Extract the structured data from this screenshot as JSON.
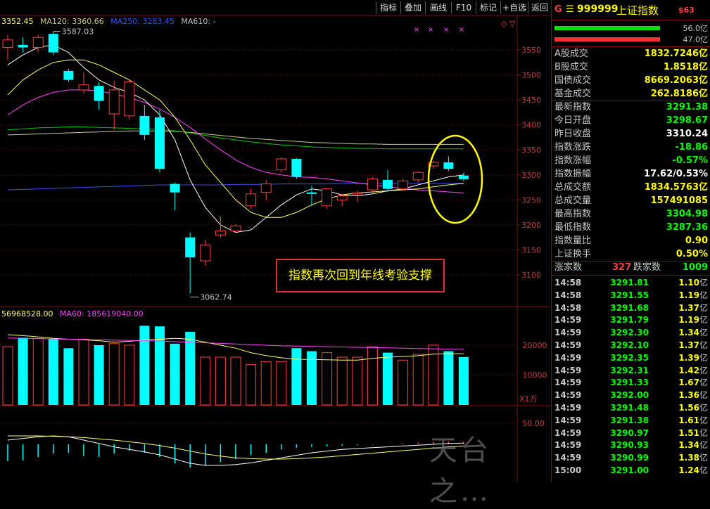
{
  "toolbar": {
    "buttons": [
      "指标",
      "叠加",
      "画线",
      "F10",
      "标记",
      "+自选",
      "返回"
    ]
  },
  "ma_legend": {
    "ma_a": "3352.45",
    "ma120": "MA120: 3360.66",
    "ma250": "MA250: 3283.45",
    "ma610": "MA610: -"
  },
  "price_axis": [
    "3550",
    "3500",
    "3450",
    "3400",
    "3350",
    "3300",
    "3250",
    "3200",
    "3150",
    "3100"
  ],
  "annotations": {
    "high_label": "3587.03",
    "low_label": "3062.74",
    "box_text": "指数再次回到年线考验支撑"
  },
  "volume": {
    "legend_vol": "56968528.00",
    "legend_ma60": "MA60: 185619040.00",
    "axis": [
      "20000",
      "10000"
    ],
    "unit": "X1万"
  },
  "macd_axis": [
    "50.00"
  ],
  "watermark": "天台之…",
  "panel": {
    "header_code": "999999",
    "header_name": "上证指数",
    "header_tag": "$63",
    "header_letter": "G",
    "bar1_pct": "56.0亿",
    "bar2_pct": "47.0亿",
    "stats": [
      {
        "label": "A股成交",
        "value": "1832.7246亿",
        "cls": "yl"
      },
      {
        "label": "B股成交",
        "value": "1.8518亿",
        "cls": "yl"
      },
      {
        "label": "国债成交",
        "value": "8669.2063亿",
        "cls": "yl"
      },
      {
        "label": "基金成交",
        "value": "262.8186亿",
        "cls": "yl"
      },
      {
        "label": "最新指数",
        "value": "3291.38",
        "cls": "dn"
      },
      {
        "label": "今日开盘",
        "value": "3298.67",
        "cls": "dn"
      },
      {
        "label": "昨日收盘",
        "value": "3310.24",
        "cls": "wt"
      },
      {
        "label": "指数涨跌",
        "value": "-18.86",
        "cls": "dn"
      },
      {
        "label": "指数涨幅",
        "value": "-0.57%",
        "cls": "dn"
      },
      {
        "label": "指数振幅",
        "value": "17.62/0.53%",
        "cls": "wt"
      },
      {
        "label": "总成交额",
        "value": "1834.5763亿",
        "cls": "yl"
      },
      {
        "label": "总成交量",
        "value": "157491085",
        "cls": "yl"
      },
      {
        "label": "最高指数",
        "value": "3304.98",
        "cls": "dn"
      },
      {
        "label": "最低指数",
        "value": "3287.36",
        "cls": "dn"
      },
      {
        "label": "指数量比",
        "value": "0.90",
        "cls": "yl"
      },
      {
        "label": "上证换手",
        "value": "0.50%",
        "cls": "yl"
      }
    ],
    "updown": {
      "up_label": "涨家数",
      "up_value": "327",
      "down_label": "跌家数",
      "down_value": "1009"
    },
    "ticks": [
      {
        "time": "14:58",
        "price": "3291.81",
        "vol": "1.10",
        "unit": "亿"
      },
      {
        "time": "14:58",
        "price": "3291.55",
        "vol": "1.19",
        "unit": "亿"
      },
      {
        "time": "14:58",
        "price": "3291.68",
        "vol": "1.37",
        "unit": "亿"
      },
      {
        "time": "14:59",
        "price": "3291.79",
        "vol": "1.19",
        "unit": "亿"
      },
      {
        "time": "14:59",
        "price": "3292.30",
        "vol": "1.34",
        "unit": "亿"
      },
      {
        "time": "14:59",
        "price": "3292.10",
        "vol": "1.37",
        "unit": "亿"
      },
      {
        "time": "14:59",
        "price": "3292.35",
        "vol": "1.39",
        "unit": "亿"
      },
      {
        "time": "14:59",
        "price": "3292.31",
        "vol": "1.42",
        "unit": "亿"
      },
      {
        "time": "14:59",
        "price": "3291.33",
        "vol": "1.67",
        "unit": "亿"
      },
      {
        "time": "14:59",
        "price": "3292.00",
        "vol": "1.36",
        "unit": "亿"
      },
      {
        "time": "14:59",
        "price": "3291.48",
        "vol": "1.56",
        "unit": "亿"
      },
      {
        "time": "14:59",
        "price": "3291.38",
        "vol": "1.61",
        "unit": "亿"
      },
      {
        "time": "14:59",
        "price": "3290.97",
        "vol": "1.51",
        "unit": "亿"
      },
      {
        "time": "14:59",
        "price": "3290.93",
        "vol": "1.34",
        "unit": "亿"
      },
      {
        "time": "14:59",
        "price": "3290.99",
        "vol": "1.38",
        "unit": "亿"
      },
      {
        "time": "15:00",
        "price": "3291.00",
        "vol": "1.24",
        "unit": "亿"
      }
    ]
  },
  "colors": {
    "up": "#ff4040",
    "down": "#00ffff",
    "ma5": "#ffffff",
    "ma10": "#ffff66",
    "ma20": "#ff44ff",
    "ma60": "#00cc00",
    "ma120": "#cccc88",
    "ma250": "#3355ff",
    "grid": "#7a1010"
  },
  "candles": [
    {
      "o": 3555,
      "c": 3570,
      "h": 3580,
      "l": 3530
    },
    {
      "o": 3560,
      "c": 3555,
      "h": 3575,
      "l": 3545
    },
    {
      "o": 3555,
      "c": 3575,
      "h": 3580,
      "l": 3545
    },
    {
      "o": 3582,
      "c": 3545,
      "h": 3587.03,
      "l": 3540
    },
    {
      "o": 3508,
      "c": 3490,
      "h": 3512,
      "l": 3486
    },
    {
      "o": 3470,
      "c": 3480,
      "h": 3505,
      "l": 3462
    },
    {
      "o": 3478,
      "c": 3448,
      "h": 3485,
      "l": 3430
    },
    {
      "o": 3422,
      "c": 3470,
      "h": 3488,
      "l": 3390
    },
    {
      "o": 3418,
      "c": 3486,
      "h": 3490,
      "l": 3410
    },
    {
      "o": 3418,
      "c": 3380,
      "h": 3440,
      "l": 3370
    },
    {
      "o": 3415,
      "c": 3312,
      "h": 3430,
      "l": 3305
    },
    {
      "o": 3282,
      "c": 3265,
      "h": 3285,
      "l": 3229
    },
    {
      "o": 3175,
      "c": 3135,
      "h": 3185,
      "l": 3062.74
    },
    {
      "o": 3128,
      "c": 3160,
      "h": 3170,
      "l": 3118
    },
    {
      "o": 3180,
      "c": 3188,
      "h": 3218,
      "l": 3175
    },
    {
      "o": 3188,
      "c": 3198,
      "h": 3202,
      "l": 3185
    },
    {
      "o": 3238,
      "c": 3262,
      "h": 3272,
      "l": 3232
    },
    {
      "o": 3265,
      "c": 3282,
      "h": 3290,
      "l": 3250
    },
    {
      "o": 3310,
      "c": 3332,
      "h": 3335,
      "l": 3305
    },
    {
      "o": 3332,
      "c": 3296,
      "h": 3334,
      "l": 3292
    },
    {
      "o": 3265,
      "c": 3262,
      "h": 3278,
      "l": 3238
    },
    {
      "o": 3238,
      "c": 3272,
      "h": 3274,
      "l": 3232
    },
    {
      "o": 3250,
      "c": 3258,
      "h": 3262,
      "l": 3238
    },
    {
      "o": 3262,
      "c": 3264,
      "h": 3268,
      "l": 3245
    },
    {
      "o": 3270,
      "c": 3292,
      "h": 3296,
      "l": 3262
    },
    {
      "o": 3290,
      "c": 3272,
      "h": 3310,
      "l": 3266
    },
    {
      "o": 3272,
      "c": 3288,
      "h": 3292,
      "l": 3268
    },
    {
      "o": 3290,
      "c": 3305,
      "h": 3307,
      "l": 3285
    },
    {
      "o": 3318,
      "c": 3325,
      "h": 3328,
      "l": 3312
    },
    {
      "o": 3325,
      "c": 3312,
      "h": 3337,
      "l": 3308
    },
    {
      "o": 3298.67,
      "c": 3291.38,
      "h": 3304.98,
      "l": 3287.36
    }
  ],
  "volumes": [
    19500,
    22500,
    22300,
    22000,
    19000,
    22000,
    20000,
    20500,
    20000,
    26500,
    26300,
    20500,
    24500,
    16000,
    16000,
    16000,
    13500,
    14500,
    14500,
    19000,
    18000,
    17500,
    16000,
    16000,
    19500,
    17500,
    15000,
    17000,
    20000,
    18000,
    16000
  ],
  "ma_lines": {
    "ma5": [
      3520,
      3540,
      3555,
      3560,
      3545,
      3515,
      3490,
      3475,
      3465,
      3450,
      3420,
      3370,
      3290,
      3235,
      3200,
      3185,
      3190,
      3215,
      3240,
      3260,
      3272,
      3268,
      3260,
      3258,
      3262,
      3268,
      3272,
      3280,
      3288,
      3296,
      3300
    ],
    "ma10": [
      3460,
      3490,
      3510,
      3525,
      3530,
      3530,
      3520,
      3505,
      3490,
      3470,
      3450,
      3415,
      3370,
      3320,
      3285,
      3250,
      3225,
      3215,
      3215,
      3225,
      3240,
      3252,
      3260,
      3264,
      3266,
      3268,
      3270,
      3272,
      3276,
      3280,
      3283
    ],
    "ma20": [
      3420,
      3440,
      3455,
      3465,
      3470,
      3470,
      3468,
      3462,
      3455,
      3445,
      3432,
      3415,
      3395,
      3372,
      3350,
      3330,
      3315,
      3305,
      3300,
      3296,
      3295,
      3292,
      3288,
      3284,
      3280,
      3276,
      3273,
      3270,
      3268,
      3266,
      3264
    ],
    "ma60": [
      3390,
      3392,
      3394,
      3395,
      3396,
      3396,
      3395,
      3394,
      3393,
      3392,
      3391,
      3388,
      3384,
      3379,
      3374,
      3370,
      3366,
      3363,
      3360,
      3358,
      3356,
      3355,
      3354,
      3353,
      3353,
      3352,
      3352,
      3352,
      3352,
      3352,
      3352
    ],
    "ma120": [
      3380,
      3381,
      3382,
      3383,
      3384,
      3385,
      3386,
      3387,
      3388,
      3388,
      3388,
      3387,
      3385,
      3382,
      3379,
      3376,
      3373,
      3371,
      3369,
      3367,
      3365,
      3364,
      3363,
      3362,
      3362,
      3361,
      3361,
      3361,
      3361,
      3361,
      3361
    ],
    "ma250": [
      3270,
      3271,
      3272,
      3273,
      3274,
      3275,
      3276,
      3277,
      3278,
      3279,
      3280,
      3280,
      3280,
      3280,
      3280,
      3281,
      3281,
      3281,
      3282,
      3282,
      3282,
      3282,
      3283,
      3283,
      3283,
      3283,
      3283,
      3283,
      3283,
      3283,
      3283
    ]
  },
  "volume_ma": {
    "ma5": [
      23500,
      23200,
      22800,
      22300,
      22000,
      21800,
      21500,
      21000,
      21300,
      21800,
      22000,
      22300,
      22000,
      21000,
      20000,
      19000,
      17500,
      16500,
      15800,
      15300,
      15200,
      15100,
      15000,
      15000,
      15600,
      16000,
      16200,
      16500,
      17000,
      17200,
      17100
    ],
    "ma60": [
      22400,
      22300,
      22200,
      22100,
      22000,
      21900,
      21800,
      21700,
      21600,
      21500,
      21400,
      21200,
      21000,
      20800,
      20600,
      20400,
      20200,
      20000,
      19800,
      19700,
      19600,
      19500,
      19400,
      19300,
      19200,
      19100,
      19000,
      18900,
      18800,
      18700,
      18600
    ]
  },
  "macd": {
    "hist": [
      -40,
      -38,
      -30,
      -22,
      -20,
      -28,
      -30,
      -22,
      -15,
      -20,
      -30,
      -45,
      -55,
      -50,
      -42,
      -35,
      -25,
      -20,
      -12,
      -8,
      -6,
      -5,
      -3,
      -2,
      -1,
      0,
      2,
      4,
      6,
      7,
      6
    ],
    "dif": [
      10,
      14,
      18,
      20,
      18,
      10,
      2,
      -6,
      -12,
      -18,
      -25,
      -35,
      -45,
      -50,
      -50,
      -48,
      -44,
      -38,
      -32,
      -26,
      -20,
      -16,
      -12,
      -10,
      -8,
      -6,
      -4,
      -2,
      0,
      2,
      3
    ],
    "dea": [
      20,
      20,
      20,
      19,
      18,
      16,
      13,
      10,
      6,
      2,
      -3,
      -9,
      -16,
      -23,
      -28,
      -32,
      -34,
      -35,
      -35,
      -34,
      -32,
      -30,
      -27,
      -24,
      -21,
      -18,
      -15,
      -12,
      -9,
      -6,
      -4
    ]
  }
}
